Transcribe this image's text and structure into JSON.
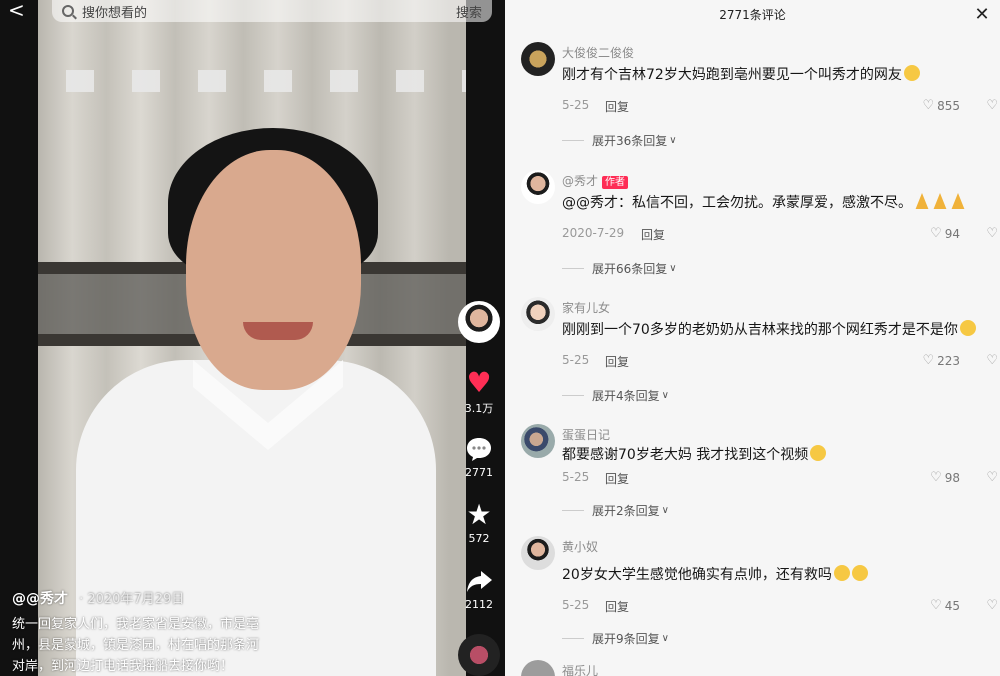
{
  "search": {
    "placeholder": "搜你想看的",
    "button_label": "搜索"
  },
  "back_label": "<",
  "video": {
    "rail": {
      "like_count": "3.1万",
      "comment_count": "2771",
      "favorite_count": "572",
      "share_count": "2112"
    },
    "caption": {
      "author": "@@秀才",
      "date": "· 2020年7月29日",
      "lines": [
        "统一回复家人们，我老家省是安徽，市是亳",
        "州，县是蒙城，镇是漆园，村在唱的那条河",
        "对岸，到河边打电话我摇船去接你哟！"
      ]
    }
  },
  "comments_panel": {
    "title": "2771条评论",
    "close_label": "✕",
    "reply_label": "回复",
    "comments": [
      {
        "name": "大俊俊二俊俊",
        "text": "刚才有个吉林72岁大妈跑到亳州要见一个叫秀才的网友",
        "date": "5-25",
        "likes": "855",
        "expand": "展开36条回复"
      },
      {
        "name": "@秀才",
        "badge": "作者",
        "text": "@@秀才：私信不回，工会勿扰。承蒙厚爱，感激不尽。",
        "date": "2020-7-29",
        "likes": "94",
        "expand": "展开66条回复"
      },
      {
        "name": "家有儿女",
        "text": "刚刚到一个70多岁的老奶奶从吉林来找的那个网红秀才是不是你",
        "date": "5-25",
        "likes": "223",
        "expand": "展开4条回复"
      },
      {
        "name": "蛋蛋日记",
        "text": "都要感谢70岁老大妈 我才找到这个视频",
        "date": "5-25",
        "likes": "98",
        "expand": "展开2条回复"
      },
      {
        "name": "黄小奴",
        "text": "20岁女大学生感觉他确实有点帅，还有救吗",
        "date": "5-25",
        "likes": "45",
        "expand": "展开9条回复"
      },
      {
        "name": "福乐儿"
      }
    ]
  },
  "colors": {
    "like_red": "#ff2e55",
    "author_badge": "#fe2c55",
    "panel_bg": "#f6f6f6"
  },
  "icons": [
    "back-arrow-icon",
    "search-icon",
    "heart-icon",
    "comment-icon",
    "star-icon",
    "share-icon",
    "close-icon",
    "heart-outline-icon",
    "chevron-down-icon"
  ]
}
